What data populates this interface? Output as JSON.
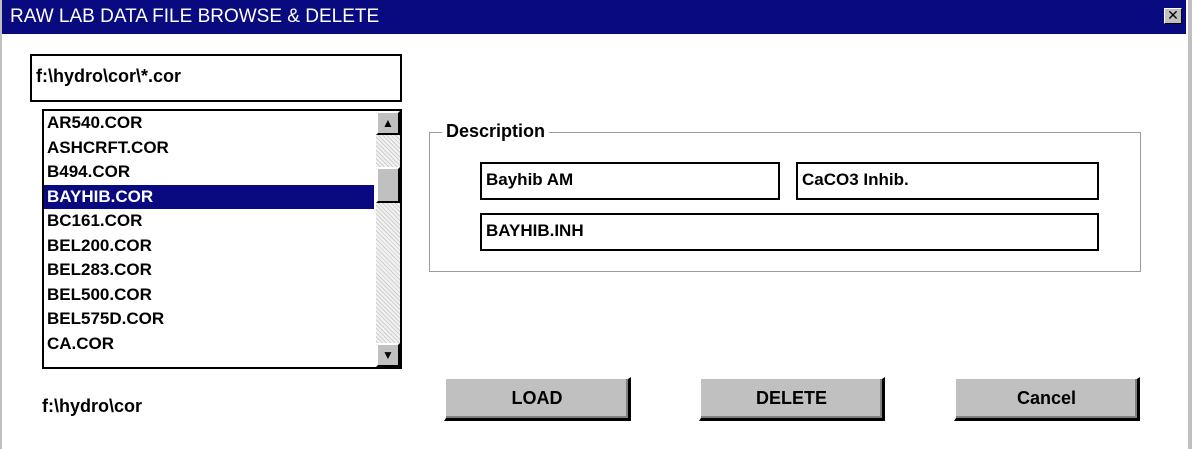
{
  "window": {
    "title": "RAW LAB DATA FILE BROWSE & DELETE",
    "close_glyph": "✕"
  },
  "file_filter": {
    "value": "f:\\hydro\\cor\\*.cor"
  },
  "file_list": {
    "items": [
      "AR540.COR",
      "ASHCRFT.COR",
      "B494.COR",
      "BAYHIB.COR",
      "BC161.COR",
      "BEL200.COR",
      "BEL283.COR",
      "BEL500.COR",
      "BEL575D.COR",
      "CA.COR"
    ],
    "selected": "BAYHIB.COR",
    "scroll_up_glyph": "▲",
    "scroll_down_glyph": "▼"
  },
  "current_dir": "f:\\hydro\\cor",
  "description": {
    "label": "Description",
    "name": "Bayhib AM",
    "type": "CaCO3 Inhib.",
    "file": "BAYHIB.INH"
  },
  "buttons": {
    "load": "LOAD",
    "delete": "DELETE",
    "cancel": "Cancel"
  }
}
